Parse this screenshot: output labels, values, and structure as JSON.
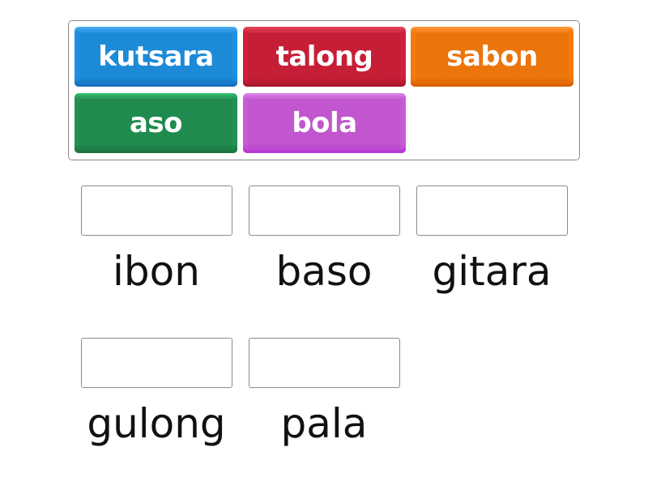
{
  "activity": {
    "type": "match-up",
    "tiles": [
      {
        "label": "kutsara",
        "color": "#1e90e0",
        "color_light": "#4fb1f2",
        "color_dark": "#146fc0"
      },
      {
        "label": "talong",
        "color": "#d0203a",
        "color_light": "#e34a5e",
        "color_dark": "#a8162b"
      },
      {
        "label": "sabon",
        "color": "#f57a0c",
        "color_light": "#ff9a3c",
        "color_dark": "#d86200"
      },
      {
        "label": "aso",
        "color": "#229152",
        "color_light": "#34c46f",
        "color_dark": "#1a7440"
      },
      {
        "label": "bola",
        "color": "#c95ad7",
        "color_light": "#dc86e6",
        "color_dark": "#b838d4"
      }
    ],
    "targets": [
      {
        "label": "ibon",
        "slot_value": ""
      },
      {
        "label": "baso",
        "slot_value": ""
      },
      {
        "label": "gitara",
        "slot_value": ""
      },
      {
        "label": "gulong",
        "slot_value": ""
      },
      {
        "label": "pala",
        "slot_value": ""
      }
    ]
  }
}
